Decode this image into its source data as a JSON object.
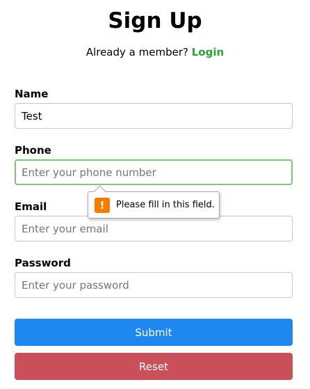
{
  "page": {
    "title": "Sign Up",
    "member_prompt": "Already a member?",
    "login_link": "Login"
  },
  "form": {
    "name": {
      "label": "Name",
      "value": "Test",
      "placeholder": ""
    },
    "phone": {
      "label": "Phone",
      "value": "",
      "placeholder": "Enter your phone number"
    },
    "email": {
      "label": "Email",
      "value": "",
      "placeholder": "Enter your email"
    },
    "password": {
      "label": "Password",
      "value": "",
      "placeholder": "Enter your password"
    }
  },
  "buttons": {
    "submit": "Submit",
    "reset": "Reset"
  },
  "validation_tooltip": {
    "message": "Please fill in this field.",
    "icon": "warning-icon",
    "icon_glyph": "!"
  },
  "colors": {
    "login_link": "#2aa43a",
    "submit_button": "#1e87f0",
    "reset_button": "#c9505a",
    "focus_border": "#7fc37f",
    "warning_icon": "#f57c00"
  }
}
